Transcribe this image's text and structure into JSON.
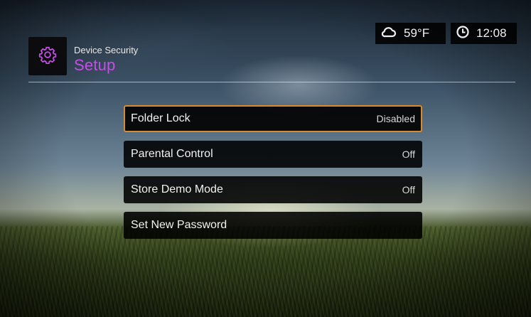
{
  "header": {
    "section": "Device Security",
    "title": "Setup",
    "icon": "gear-icon",
    "accent_color": "#c44ee6"
  },
  "status": {
    "weather_icon": "cloud-icon",
    "temperature": "59°F",
    "clock_icon": "clock-icon",
    "time": "12:08"
  },
  "menu": {
    "selected_color": "#d98a2e",
    "items": [
      {
        "label": "Folder Lock",
        "value": "Disabled",
        "selected": true
      },
      {
        "label": "Parental Control",
        "value": "Off"
      },
      {
        "label": "Store Demo Mode",
        "value": "Off"
      },
      {
        "label": "Set New Password",
        "value": ""
      }
    ]
  }
}
